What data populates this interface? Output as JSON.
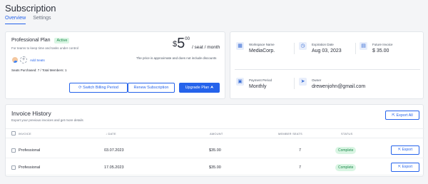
{
  "page": {
    "title": "Subscription",
    "tabs": [
      {
        "label": "Overview",
        "active": true
      },
      {
        "label": "Settings",
        "active": false
      }
    ]
  },
  "plan": {
    "name": "Professional Plan",
    "badge": "Active",
    "subtitle": "For teams to keep time and tasks under control",
    "add_seats": "Add Seats",
    "seats_info": "Seats Purchased: 7 / Total Members: 1",
    "price_currency": "$",
    "price_int": "5",
    "price_cents": "00",
    "price_unit": "/ seat / month",
    "price_note": "The price is approximate and does not include discounts",
    "buttons": {
      "switch": "Switch Billing Period",
      "renew": "Renew Subscription",
      "upgrade": "Upgrade Plan"
    }
  },
  "info": {
    "workspace": {
      "label": "Workspace Name",
      "value": "MediaCorp.",
      "icon": "building-icon"
    },
    "expiration": {
      "label": "Expiration Date",
      "value": "Aug 03, 2023",
      "icon": "clock-icon"
    },
    "future_invoice": {
      "label": "Future Invoice",
      "value": "$ 35.00",
      "icon": "invoice-icon"
    },
    "payment_period": {
      "label": "Payment Period",
      "value": "Monthly",
      "icon": "calendar-icon"
    },
    "owner": {
      "label": "Owner",
      "value": "drewenjohn@gmail.com",
      "icon": "send-icon"
    }
  },
  "invoices": {
    "title": "Invoice History",
    "subtitle": "Export your previous invoices and get more details",
    "export_all": "Export All",
    "headers": {
      "invoice": "INVOICE",
      "date": "DATE",
      "amount": "AMOUNT",
      "member_seats": "MEMBER SEATS",
      "status": "STATUS"
    },
    "rows": [
      {
        "invoice": "Professional",
        "date": "03.07.2023",
        "amount": "$35.00",
        "seats": "7",
        "status": "Complete",
        "action": "Export"
      },
      {
        "invoice": "Professional",
        "date": "17.05.2023",
        "amount": "$35.00",
        "seats": "7",
        "status": "Complete",
        "action": "Export"
      }
    ]
  },
  "colors": {
    "accent": "#2563eb",
    "success_bg": "#d9f5e3",
    "success_text": "#1f8a4c"
  }
}
